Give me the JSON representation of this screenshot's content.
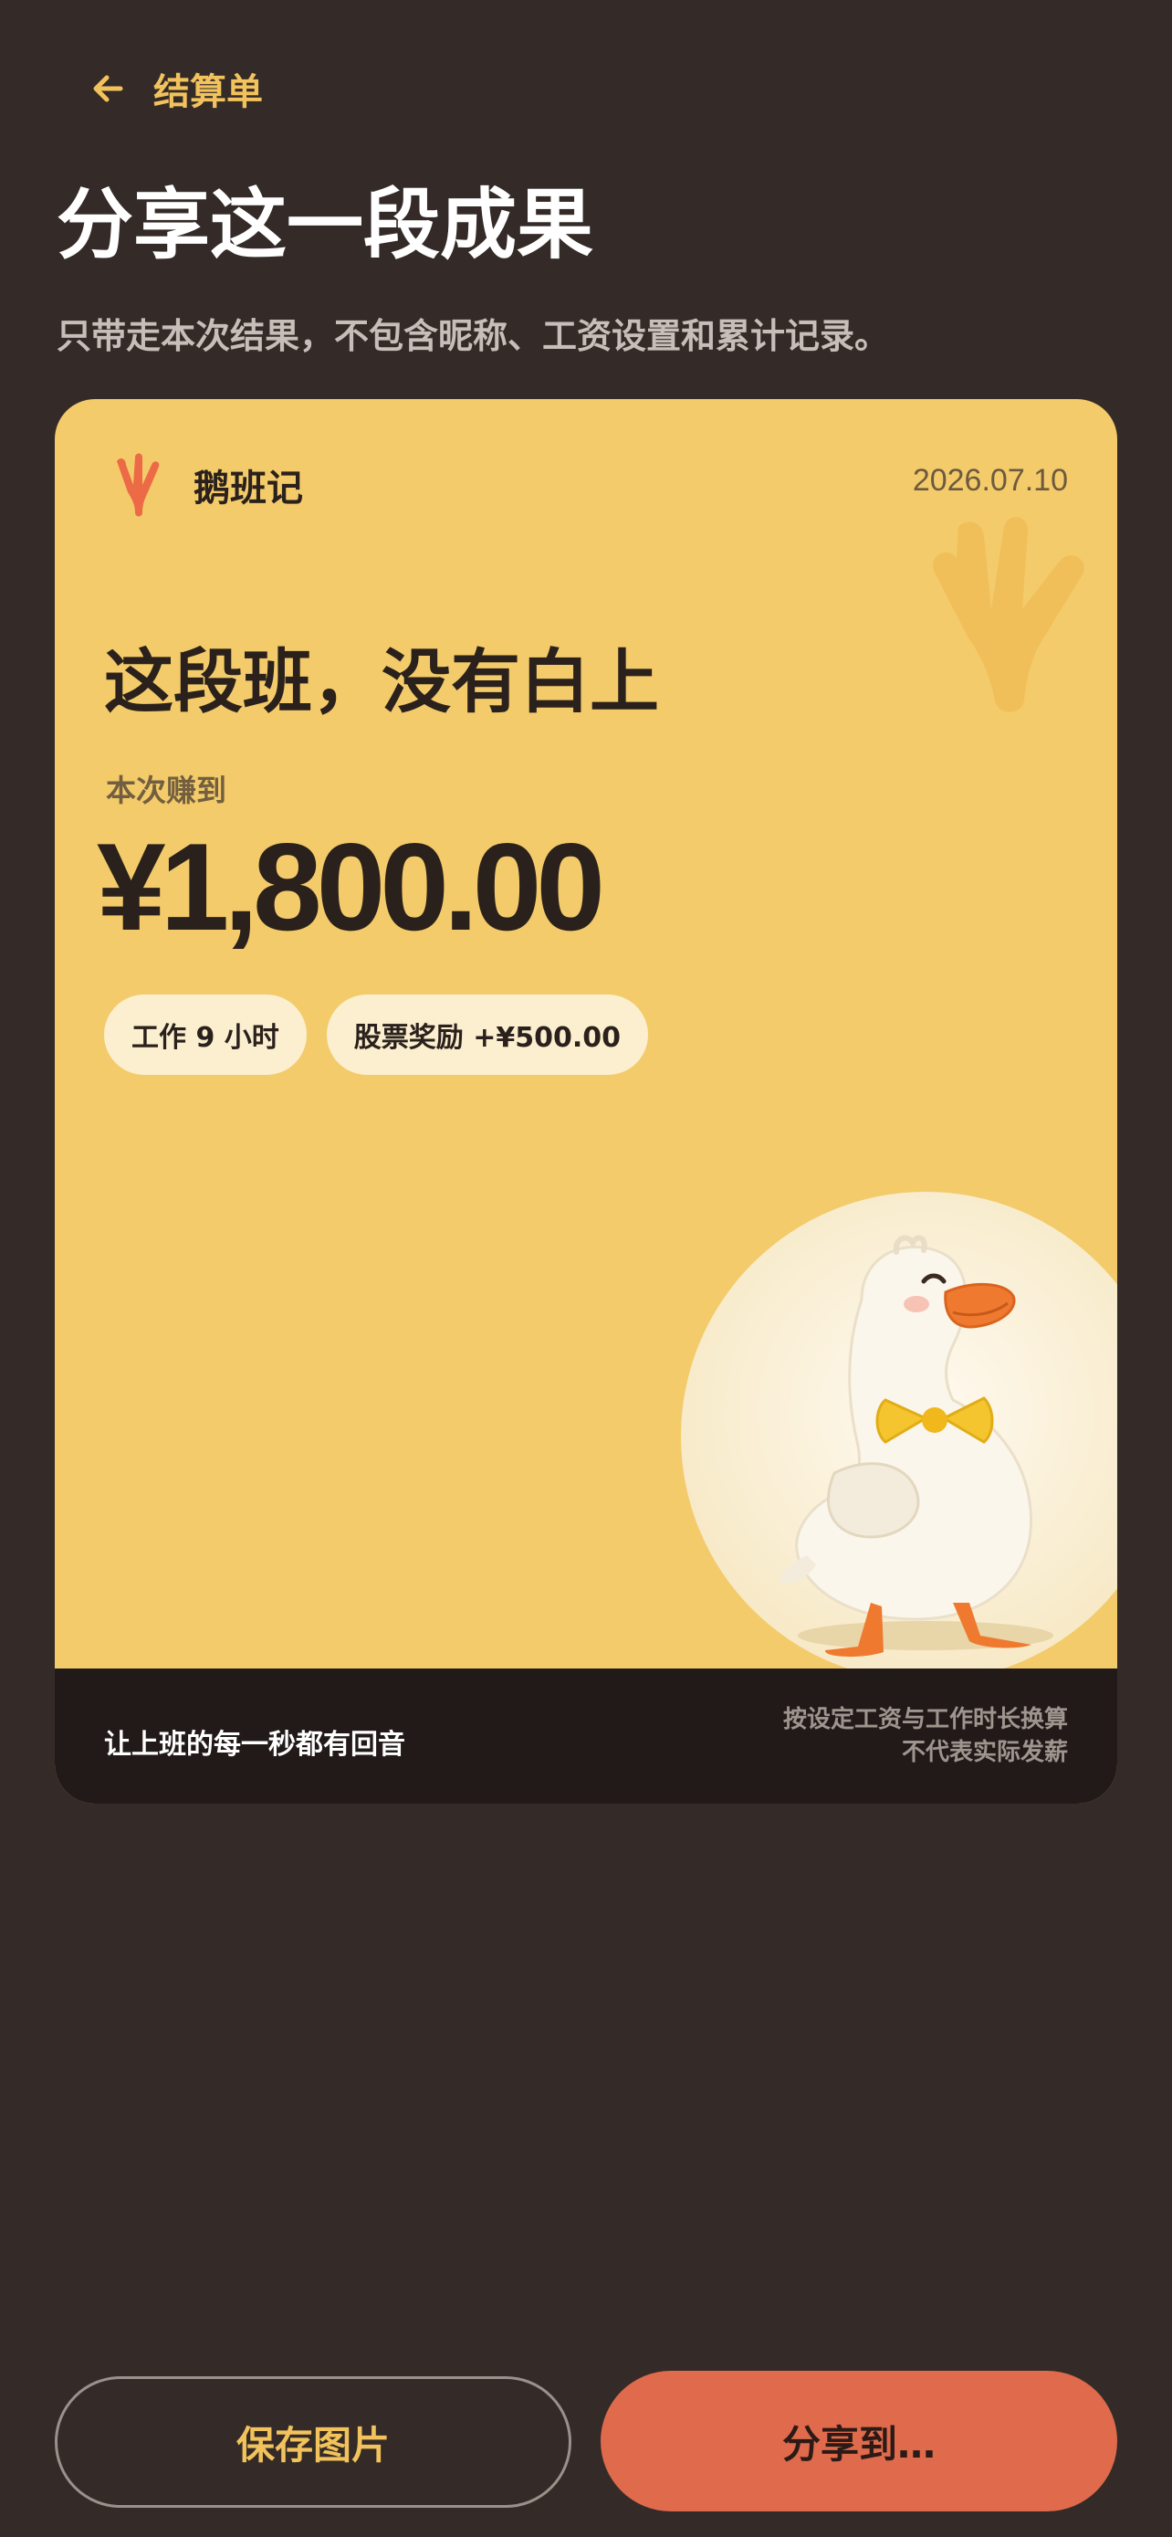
{
  "nav": {
    "back_icon": "arrow-left-icon",
    "title": "结算单"
  },
  "header": {
    "title": "分享这一段成果",
    "subtitle": "只带走本次结果，不包含昵称、工资设置和累计记录。"
  },
  "card": {
    "brand_name": "鹅班记",
    "logo_icon": "goose-foot-icon",
    "date": "2026.07.10",
    "headline": "这段班，没有白上",
    "earn_label": "本次赚到",
    "amount": "¥1,800.00",
    "chips": [
      {
        "label": "工作 9 小时"
      },
      {
        "label": "股票奖励 +¥500.00"
      }
    ],
    "footer": {
      "slogan": "让上班的每一秒都有回音",
      "disclaimer_line1": "按设定工资与工作时长换算",
      "disclaimer_line2": "不代表实际发薪"
    },
    "colors": {
      "background": "#f3cb6a",
      "footer": "#211a18",
      "chip": "#fbefd0",
      "logo": "#ec6a45"
    }
  },
  "actions": {
    "save_label": "保存图片",
    "share_label": "分享到…"
  },
  "theme": {
    "page_background": "#342b28",
    "accent": "#f2c35c",
    "primary_button": "#df6a4c"
  }
}
